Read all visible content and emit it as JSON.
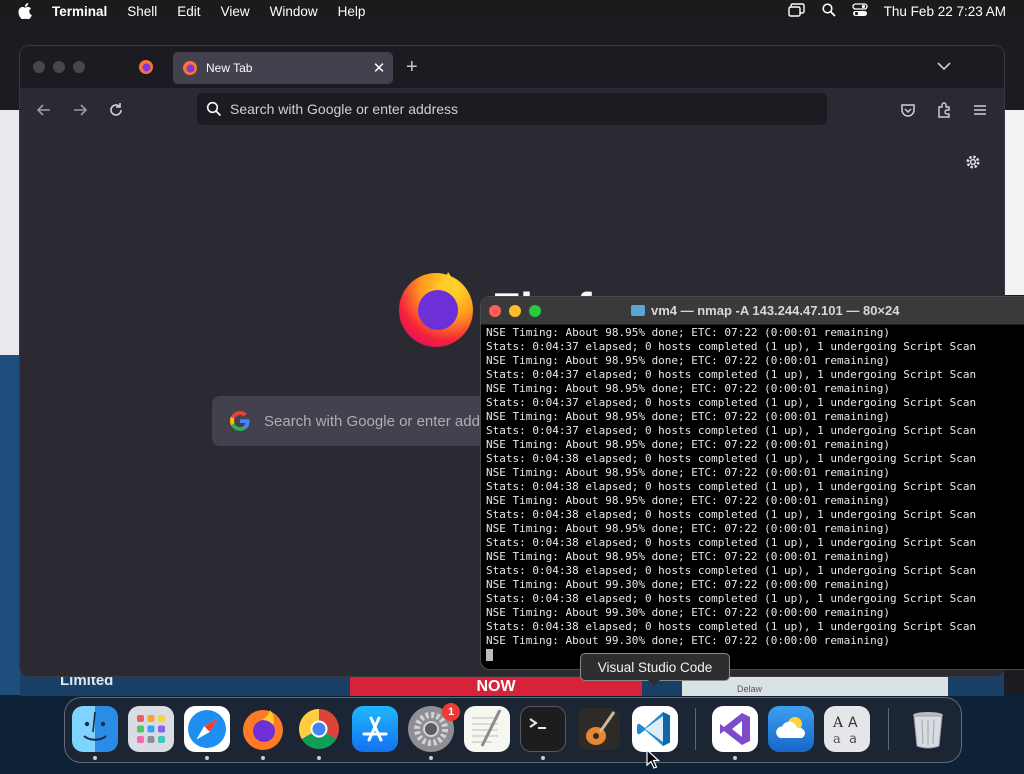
{
  "menubar": {
    "app_name": "Terminal",
    "menus": [
      "Shell",
      "Edit",
      "View",
      "Window",
      "Help"
    ],
    "clock": "Thu Feb 22  7:23 AM",
    "status_icons": [
      "screen-mirroring-icon",
      "spotlight-search-icon",
      "control-center-icon"
    ]
  },
  "background": {
    "ad_text": "Limited",
    "ad_button": "NOW",
    "map_label": "Delaw"
  },
  "firefox": {
    "tab_label": "New Tab",
    "url_placeholder": "Search with Google or enter address",
    "wordmark": "Firefox",
    "search_placeholder": "Search with Google or enter address"
  },
  "terminal": {
    "title": "vm4 — nmap -A 143.244.47.101 — 80×24",
    "lines": [
      "NSE Timing: About 98.95% done; ETC: 07:22 (0:00:01 remaining)",
      "Stats: 0:04:37 elapsed; 0 hosts completed (1 up), 1 undergoing Script Scan",
      "NSE Timing: About 98.95% done; ETC: 07:22 (0:00:01 remaining)",
      "Stats: 0:04:37 elapsed; 0 hosts completed (1 up), 1 undergoing Script Scan",
      "NSE Timing: About 98.95% done; ETC: 07:22 (0:00:01 remaining)",
      "Stats: 0:04:37 elapsed; 0 hosts completed (1 up), 1 undergoing Script Scan",
      "NSE Timing: About 98.95% done; ETC: 07:22 (0:00:01 remaining)",
      "Stats: 0:04:37 elapsed; 0 hosts completed (1 up), 1 undergoing Script Scan",
      "NSE Timing: About 98.95% done; ETC: 07:22 (0:00:01 remaining)",
      "Stats: 0:04:38 elapsed; 0 hosts completed (1 up), 1 undergoing Script Scan",
      "NSE Timing: About 98.95% done; ETC: 07:22 (0:00:01 remaining)",
      "Stats: 0:04:38 elapsed; 0 hosts completed (1 up), 1 undergoing Script Scan",
      "NSE Timing: About 98.95% done; ETC: 07:22 (0:00:01 remaining)",
      "Stats: 0:04:38 elapsed; 0 hosts completed (1 up), 1 undergoing Script Scan",
      "NSE Timing: About 98.95% done; ETC: 07:22 (0:00:01 remaining)",
      "Stats: 0:04:38 elapsed; 0 hosts completed (1 up), 1 undergoing Script Scan",
      "NSE Timing: About 98.95% done; ETC: 07:22 (0:00:01 remaining)",
      "Stats: 0:04:38 elapsed; 0 hosts completed (1 up), 1 undergoing Script Scan",
      "NSE Timing: About 99.30% done; ETC: 07:22 (0:00:00 remaining)",
      "Stats: 0:04:38 elapsed; 0 hosts completed (1 up), 1 undergoing Script Scan",
      "NSE Timing: About 99.30% done; ETC: 07:22 (0:00:00 remaining)",
      "Stats: 0:04:38 elapsed; 0 hosts completed (1 up), 1 undergoing Script Scan",
      "NSE Timing: About 99.30% done; ETC: 07:22 (0:00:00 remaining)"
    ]
  },
  "tooltip": "Visual Studio Code",
  "dock": {
    "badge_count": "1",
    "items": [
      "finder-icon",
      "launchpad-icon",
      "safari-icon",
      "firefox-icon",
      "chrome-icon",
      "app-store-icon",
      "system-settings-icon",
      "textedit-icon",
      "terminal-icon",
      "garageband-icon",
      "vscode-icon",
      "visual-studio-icon",
      "weather-icon",
      "font-book-icon",
      "trash-icon"
    ]
  },
  "colors": {
    "traffic_red": "#ff5f57",
    "traffic_yellow": "#febc2e",
    "traffic_green": "#28c840",
    "firefox_tab": "#42414d",
    "terminal_bg": "#000000"
  }
}
